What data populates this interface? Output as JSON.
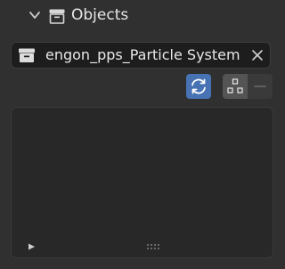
{
  "panel": {
    "title": "Objects",
    "chevron_icon": "chevron-down-icon",
    "header_icon": "collection-box-icon"
  },
  "collection_field": {
    "value": "engon_pps_Particle System",
    "icon": "collection-box-icon",
    "clear_icon": "close-icon"
  },
  "toolbar": {
    "refresh_icon": "refresh-icon",
    "select_icon": "select-points-icon",
    "remove_icon": "minus-icon",
    "refresh_active": true
  },
  "list": {
    "items": [],
    "expand_icon": "triangle-right-icon",
    "grip_icon": "resize-grip-icon"
  },
  "colors": {
    "background": "#303030",
    "field_bg": "#1d1d1d",
    "accent": "#4772b3",
    "list_bg": "#282828"
  }
}
